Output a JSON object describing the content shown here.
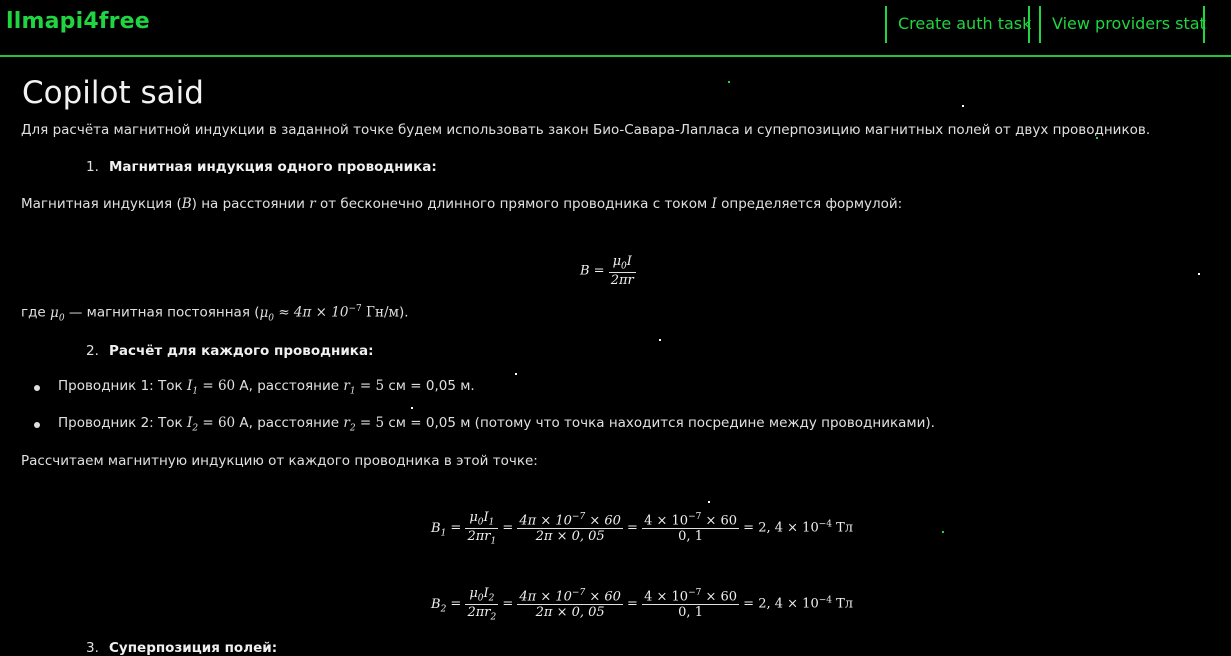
{
  "header": {
    "brand": "llmapi4free",
    "nav": {
      "create_auth_task": "Create auth task",
      "view_providers_stat": "View providers stat"
    }
  },
  "main": {
    "title": "Copilot said",
    "intro": "Для расчёта магнитной индукции в заданной точке будем использовать закон Био-Савара-Лапласа и суперпозицию магнитных полей от двух проводников.",
    "step1": {
      "number": "1.",
      "heading": "Магнитная индукция одного проводника:"
    },
    "p_induction": {
      "t1": "Магнитная индукция (",
      "t2": ") на расстоянии ",
      "t3": " от бесконечно длинного прямого проводника с током ",
      "t4": " определяется формулой:"
    },
    "formula_main": {
      "lhs": "B =",
      "num": "μ",
      "num_sub": "0",
      "num_var": "I",
      "den": "2πr"
    },
    "p_mu": {
      "t1": "где ",
      "t2": " — магнитная постоянная (",
      "approx": " ≈ 4π × 10",
      "exp": "−7",
      "unit": " Гн/м",
      "t3": ")."
    },
    "step2": {
      "number": "2.",
      "heading": "Расчёт для каждого проводника:"
    },
    "bullet1": {
      "t1": "Проводник 1: Ток ",
      "cur": " = 60",
      "t2": " А, расстояние ",
      "dist": " = 5",
      "t3": " см = 0,05 м."
    },
    "bullet2": {
      "t1": "Проводник 2: Ток ",
      "cur": " = 60",
      "t2": " А, расстояние ",
      "dist": " = 5",
      "t3": " см = 0,05 м (потому что точка находится посредине между проводниками)."
    },
    "p_calc": "Рассчитаем магнитную индукцию от каждого проводника в этой точке:",
    "formula_b1": {
      "lhs": "B",
      "lhs_sub": "1",
      "eq": " = ",
      "f1_num": "μ",
      "f1_num_sub": "0",
      "f1_num_var": "I",
      "f1_num_var_sub": "1",
      "f1_den": "2πr",
      "f1_den_sub": "1",
      "f2_num": "4π × 10",
      "f2_num_exp": "−7",
      "f2_num_tail": " × 60",
      "f2_den": "2π × 0, 05",
      "f3_num": "4 × 10",
      "f3_num_exp": "−7",
      "f3_num_tail": " × 60",
      "f3_den": "0, 1",
      "result": " = 2, 4 × 10",
      "result_exp": "−4",
      "unit": " Тл"
    },
    "formula_b2": {
      "lhs": "B",
      "lhs_sub": "2",
      "eq": " = ",
      "f1_num": "μ",
      "f1_num_sub": "0",
      "f1_num_var": "I",
      "f1_num_var_sub": "2",
      "f1_den": "2πr",
      "f1_den_sub": "2",
      "f2_num": "4π × 10",
      "f2_num_exp": "−7",
      "f2_num_tail": " × 60",
      "f2_den": "2π × 0, 05",
      "f3_num": "4 × 10",
      "f3_num_exp": "−7",
      "f3_num_tail": " × 60",
      "f3_den": "0, 1",
      "result": " = 2, 4 × 10",
      "result_exp": "−4",
      "unit": " Тл"
    },
    "step3": {
      "number": "3.",
      "heading": "Суперпозиция полей:"
    }
  },
  "colors": {
    "accent": "#1fd640",
    "background": "#000000",
    "text": "#e0e0e0"
  }
}
